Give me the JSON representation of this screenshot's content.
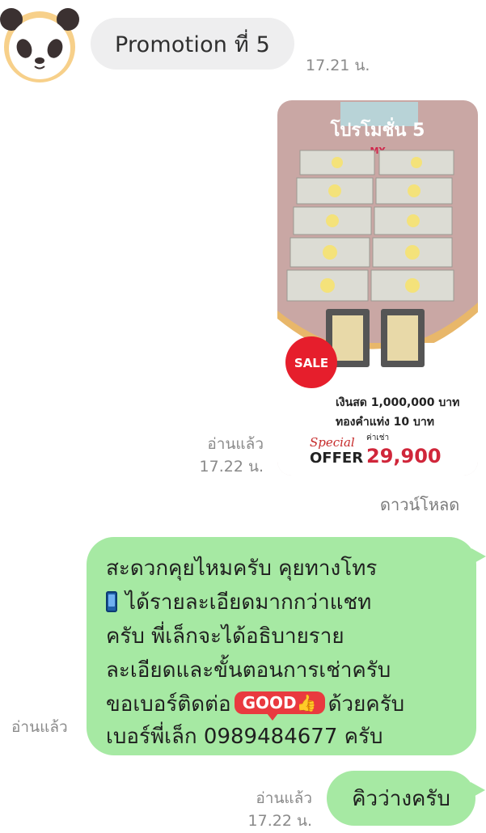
{
  "messages": {
    "incoming_1": {
      "text": "Promotion ที่ 5",
      "time": "17.21 น."
    },
    "image_message": {
      "read": "อ่านแล้ว",
      "time": "17.22 น.",
      "download_label": "ดาวน์โหลด",
      "image": {
        "heading": "โปรโมชั่น 5",
        "brand": "MY",
        "sale_badge": "SALE",
        "cash_line": "เงินสด 1,000,000 บาท",
        "gold_line": "ทองคำแท่ง 10 บาท",
        "special_label": "Special",
        "offer_label": "OFFER",
        "price_caption": "ค่าเช่า",
        "price": "29,900"
      }
    },
    "outgoing_1": {
      "line1": "สะดวกคุยไหมครับ คุยทางโทร",
      "line2": "ได้รายละเอียดมากกว่าแชท",
      "line3": "ครับ พี่เล็กจะได้อธิบายราย",
      "line4": "ละเอียดและขั้นตอนการเช่าครับ",
      "line5_pre": "ขอเบอร์ติดต่อ",
      "sticker": "GOOD👍",
      "line5_post": "ด้วยครับ",
      "line6": "เบอร์พี่เล็ก 0989484677 ครับ",
      "read": "อ่านแล้ว",
      "icon": "phone-icon"
    },
    "outgoing_2": {
      "text": "คิวว่างครับ",
      "read": "อ่านแล้ว",
      "time": "17.22 น."
    }
  },
  "colors": {
    "outgoing_bubble": "#a6e9a3",
    "incoming_bubble": "#eeeeef",
    "meta_text": "#8a8a8a"
  }
}
